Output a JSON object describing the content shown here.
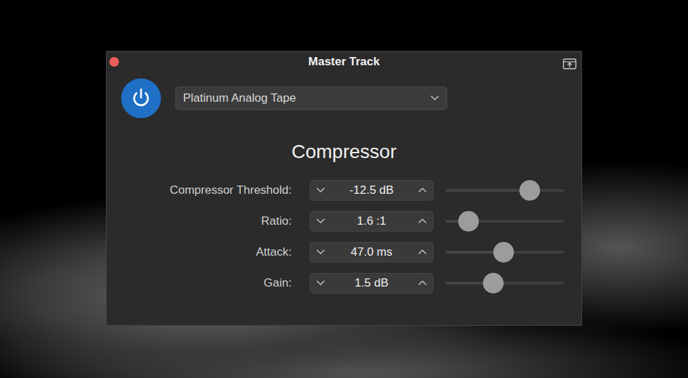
{
  "window": {
    "title": "Master Track"
  },
  "power": {
    "on": true
  },
  "preset": {
    "value": "Platinum Analog Tape"
  },
  "section": {
    "title": "Compressor"
  },
  "params": [
    {
      "label": "Compressor Threshold:",
      "value": "-12.5 dB",
      "level": 0.71
    },
    {
      "label": "Ratio:",
      "value": "1.6 :1",
      "level": 0.19
    },
    {
      "label": "Attack:",
      "value": "47.0 ms",
      "level": 0.49
    },
    {
      "label": "Gain:",
      "value": "1.5 dB",
      "level": 0.4
    }
  ]
}
